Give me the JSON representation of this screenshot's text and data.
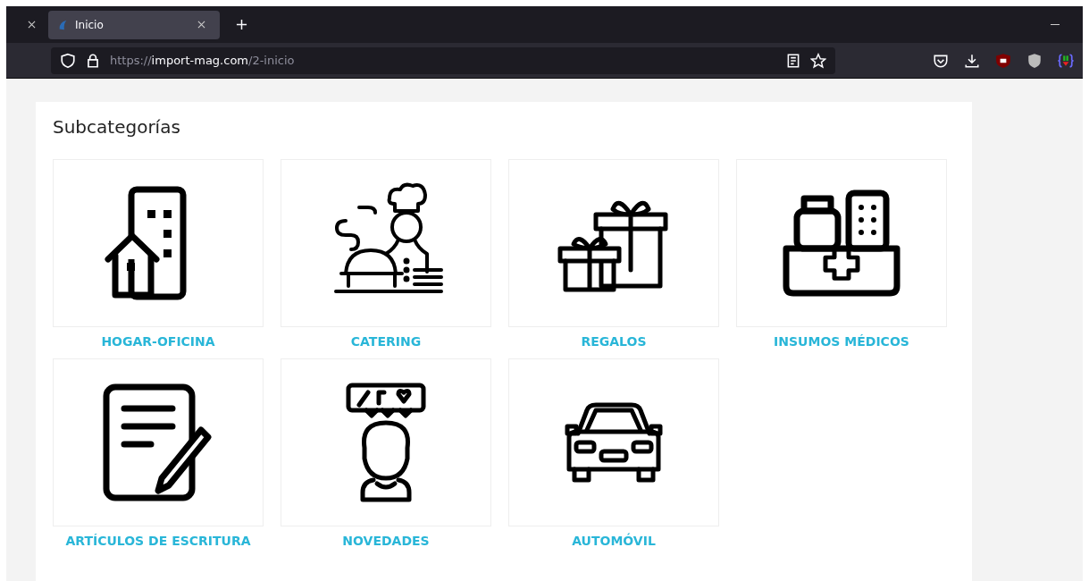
{
  "browser": {
    "tabs": [
      {
        "title": "Inicio",
        "selected": true
      }
    ],
    "address": {
      "scheme": "https://",
      "host": "import-mag.com",
      "path": "/2-inicio"
    }
  },
  "page": {
    "title": "Subcategorías",
    "categories": [
      {
        "label": "HOGAR-OFICINA"
      },
      {
        "label": "CATERING"
      },
      {
        "label": "REGALOS"
      },
      {
        "label": "INSUMOS MÉDICOS"
      },
      {
        "label": "ARTÍCULOS DE ESCRITURA"
      },
      {
        "label": "NOVEDADES"
      },
      {
        "label": "AUTOMÓVIL"
      }
    ]
  }
}
